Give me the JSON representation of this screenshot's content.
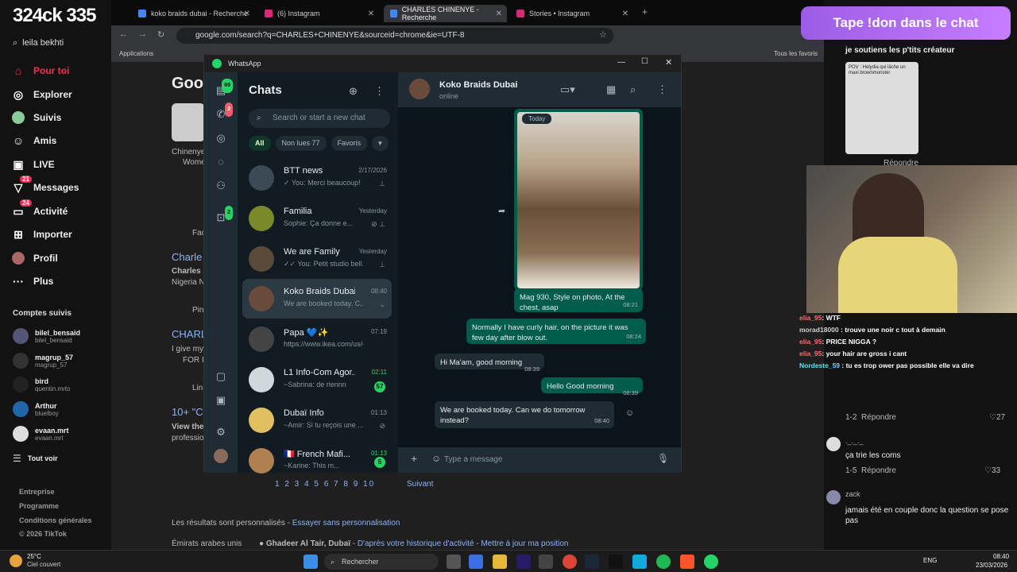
{
  "tiktok_left": {
    "logo": "324ck 335",
    "search_value": "leila bekhti",
    "nav": [
      {
        "label": "Pour toi",
        "icon": "home-icon"
      },
      {
        "label": "Explorer",
        "icon": "compass-icon"
      },
      {
        "label": "Suivis",
        "icon": "following-icon"
      },
      {
        "label": "Amis",
        "icon": "friends-icon"
      },
      {
        "label": "LIVE",
        "icon": "live-icon"
      },
      {
        "label": "Messages",
        "icon": "messages-icon",
        "badge": "21"
      },
      {
        "label": "Activité",
        "icon": "activity-icon",
        "badge": "24"
      },
      {
        "label": "Importer",
        "icon": "upload-icon"
      },
      {
        "label": "Profil",
        "icon": "profile-icon"
      },
      {
        "label": "Plus",
        "icon": "more-icon"
      }
    ],
    "following_title": "Comptes suivis",
    "following": [
      {
        "name": "bilel_bensaid",
        "handle": "bilel_bensaid"
      },
      {
        "name": "magrup_57",
        "handle": "magrup_57"
      },
      {
        "name": "bird",
        "handle": "quentin.mrto"
      },
      {
        "name": "Arthur",
        "handle": "bluelboy"
      },
      {
        "name": "evaan.mrt",
        "handle": "evaan.mrt"
      }
    ],
    "see_all": "Tout voir",
    "footer": [
      "Entreprise",
      "Programme",
      "Conditions générales",
      "© 2026 TikTok"
    ]
  },
  "chrome": {
    "tabs": [
      {
        "label": "koko braids dubai - Recherche",
        "color": "#4285f4"
      },
      {
        "label": "(6) Instagram",
        "color": "#d62976"
      },
      {
        "label": "CHARLES CHINENYE - Recherche",
        "color": "#4285f4"
      },
      {
        "label": "Stories • Instagram",
        "color": "#d62976"
      }
    ],
    "url": "google.com/search?q=CHARLES+CHINENYE&sourceid=chrome&ie=UTF-8",
    "bookmarks_apps": "Applications",
    "bookmarks_all": "Tous les favoris",
    "page": {
      "logo": "Goog",
      "snippet_chinenye": "Chinenye",
      "snippet_women": "Wome",
      "fac": "Fac",
      "charles_link": "Charle",
      "charles_k": "Charles K",
      "nigeria": "Nigeria N",
      "pin": "Pin",
      "charl_link": "CHARL",
      "give": "I give my",
      "for": "FOR I",
      "lin": "Lin",
      "tenc": "10+ \"C",
      "view": "View the",
      "prof": "professio",
      "pages": "1 2 3 4 5 6 7 8 9 10",
      "next": "Suivant",
      "personalized": "Les résultats sont personnalisés -",
      "try_without": "Essayer sans personnalisation",
      "region": "Émirats arabes unis",
      "location": "Ghadeer Al Tair, Dubaï",
      "location_note": "D'après votre historique d'activité",
      "update_location": "Mettre à jour ma position"
    }
  },
  "whatsapp": {
    "window_title": "WhatsApp",
    "rail_badges": {
      "chats": "69",
      "calls": "2",
      "updates": "2"
    },
    "list_title": "Chats",
    "search_placeholder": "Search or start a new chat",
    "filters": [
      "All",
      "Non lues 77",
      "Favoris"
    ],
    "chats": [
      {
        "name": "BTT news",
        "preview": "✓ You: Merci beaucoup!",
        "time": "2/17/2026",
        "meta": "pin",
        "color": "#3b4a54"
      },
      {
        "name": "Familia",
        "preview": "Sophie: Ça donne e...",
        "time": "Yesterday",
        "meta": "muted-pin",
        "color": "#7a8a2a"
      },
      {
        "name": "We are Family",
        "preview": "✓✓ You: Petit studio bell...",
        "time": "Yesterday",
        "meta": "pin",
        "color": "#5a4a3a"
      },
      {
        "name": "Koko Braids Dubai",
        "preview": "We are booked today. C...",
        "time": "08:40",
        "meta": "chevron",
        "color": "#6a4a3a"
      },
      {
        "name": "Papa 💙✨",
        "preview": "https://www.ikea.com/us/e...",
        "time": "07:19",
        "meta": "",
        "color": "#444"
      },
      {
        "name": "L1 Info-Com Agor...",
        "preview": "~Sabrina: de riennn",
        "time": "02:11",
        "meta": "57",
        "color": "#cfd8dc"
      },
      {
        "name": "Dubaï Info",
        "preview": "~Amir: Si tu reçois une ...",
        "time": "01:13",
        "meta": "muted",
        "color": "#e0c060"
      },
      {
        "name": "🇫🇷 French Mafi...",
        "preview": "~Karine: This m...",
        "time": "01:13",
        "meta": "5",
        "color": "#b08050"
      }
    ],
    "conversation": {
      "name": "Koko Braids Dubai",
      "status": "online",
      "date_pill": "Today",
      "messages": [
        {
          "dir": "out",
          "text": "Mag 930, Style on photo, At the chest, asap",
          "time": "08:21"
        },
        {
          "dir": "out",
          "text": "Normally I have curly hair, on the picture it was few day after blow out.",
          "time": "08:24"
        },
        {
          "dir": "in",
          "text": "Hi Ma'am, good morning",
          "time": "08:39"
        },
        {
          "dir": "out",
          "text": "Hello Good morning",
          "time": "08:39"
        },
        {
          "dir": "in",
          "text": "We are booked today. Can we do tomorrow instead?",
          "time": "08:40"
        }
      ],
      "compose_placeholder": "Type a message"
    }
  },
  "tiktok_right": {
    "donation_banner": "Tape !don dans le chat",
    "top_comment": "je soutiens les p'tits créateur",
    "thumb_text": "POV : Helydia qui lâche un maxi brownmonster",
    "reply_1": "Répondre",
    "overlay_chat": [
      {
        "user": "elia_95",
        "text": "WTF"
      },
      {
        "user": "morad18000",
        "text": "trouve une noir c tout à demain"
      },
      {
        "user": "elia_95",
        "text": "PRICE NIGGA ?"
      },
      {
        "user": "elia_95",
        "text": "your hair are gross i cant"
      },
      {
        "user": "Nordeste_59",
        "text": "tu es trop ower pas possible elle va dire"
      }
    ],
    "reply_count_1": "1-2",
    "reply_2": "Répondre",
    "likes_2": "27",
    "comment_3_user": "._._._",
    "comment_3_text": "ça trie les coms",
    "reply_count_3": "1-5",
    "reply_3": "Répondre",
    "likes_3": "33",
    "comment_4_user": "zack",
    "comment_4_text": "jamais été en couple donc la question se pose pas"
  },
  "taskbar": {
    "weather_temp": "25°C",
    "weather_desc": "Ciel couvert",
    "search_label": "Rechercher",
    "lang": "ENG",
    "time": "08:40",
    "date": "23/03/2026"
  }
}
